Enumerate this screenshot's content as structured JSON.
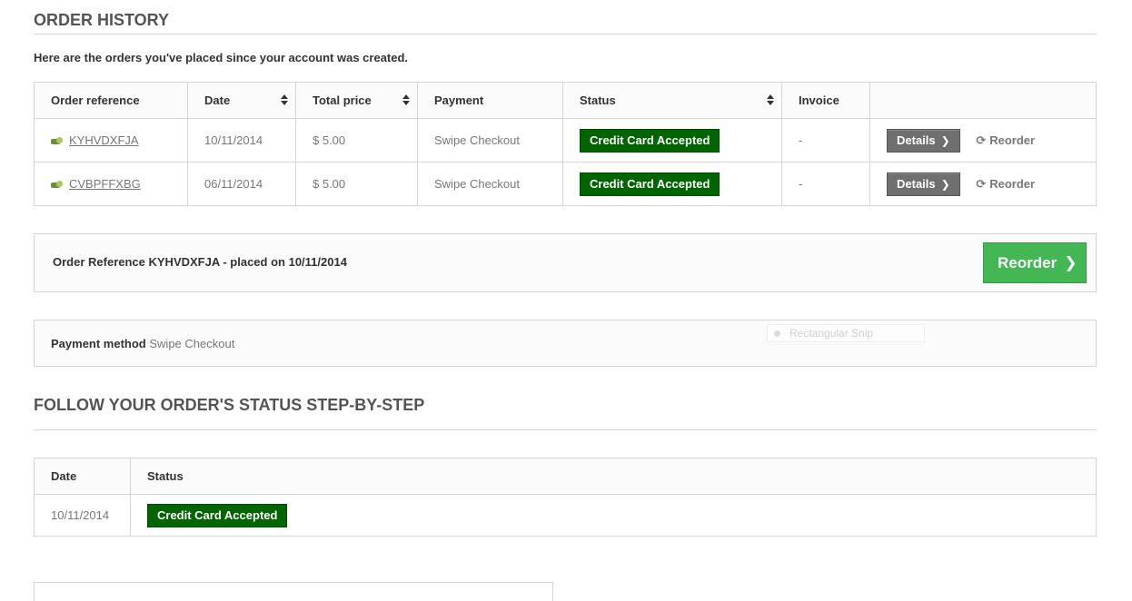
{
  "page_title": "ORDER HISTORY",
  "intro": "Here are the orders you've placed since your account was created.",
  "orders_table": {
    "headers": [
      "Order reference",
      "Date",
      "Total price",
      "Payment",
      "Status",
      "Invoice",
      ""
    ],
    "rows": [
      {
        "reference": "KYHVDXFJA",
        "date": "10/11/2014",
        "total": "$ 5.00",
        "payment": "Swipe Checkout",
        "status": "Credit Card Accepted",
        "invoice": "-",
        "details_label": "Details",
        "reorder_label": "Reorder"
      },
      {
        "reference": "CVBPFFXBG",
        "date": "06/11/2014",
        "total": "$ 5.00",
        "payment": "Swipe Checkout",
        "status": "Credit Card Accepted",
        "invoice": "-",
        "details_label": "Details",
        "reorder_label": "Reorder"
      }
    ]
  },
  "order_detail": {
    "reference_text": "Order Reference KYHVDXFJA - placed on 10/11/2014",
    "reorder_button": "Reorder",
    "payment_label": "Payment method",
    "payment_value": "Swipe Checkout",
    "snip_overlay": "Rectangular Snip"
  },
  "status_section": {
    "title": "FOLLOW YOUR ORDER'S STATUS STEP-BY-STEP",
    "headers": [
      "Date",
      "Status"
    ],
    "rows": [
      {
        "date": "10/11/2014",
        "status": "Credit Card Accepted"
      }
    ]
  },
  "colors": {
    "status_badge": "#006400",
    "reorder_button": "#43b754",
    "details_button": "#6f6f6f",
    "heading": "#555454",
    "border": "#d6d4d4"
  },
  "icons": {
    "reference": "order-reference-icon",
    "sort": "sort-icon",
    "chevron": "chevron-right-icon",
    "refresh": "refresh-icon"
  }
}
